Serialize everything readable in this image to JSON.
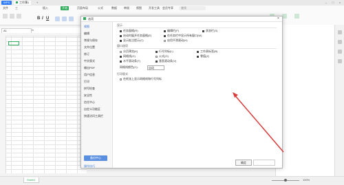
{
  "titlebar": {
    "app_name": "WPS",
    "tab_label": "工作簿1",
    "add_tab": "+"
  },
  "menubar": {
    "items": [
      "文件",
      "三",
      "插入",
      "开始",
      "页面布局",
      "公式",
      "数据",
      "审阅",
      "视图",
      "开发工具",
      "会员专享"
    ],
    "search_placeholder": "查找"
  },
  "formulabar": {
    "cell_ref": "A1",
    "fx": "fx"
  },
  "dialog": {
    "title": "选项",
    "close": "×",
    "nav": [
      "视图",
      "编辑",
      "常规与保存",
      "文件位置",
      "修订",
      "中文版式",
      "输出PDF",
      "用户信息",
      "打印",
      "拼写检查",
      "安全性",
      "信任中心",
      "自定义功能区",
      "快速访问工具栏"
    ],
    "backup_button": "备份中心",
    "tips_link": "操作技巧",
    "sections": {
      "show": "显示",
      "window": "窗口选项"
    },
    "show_options": [
      {
        "label": "任务窗格(R)",
        "checked": true
      },
      {
        "label": "编辑栏(F)",
        "checked": true
      },
      {
        "label": "状态栏(S)",
        "checked": true
      },
      {
        "label": "启动时展开任务窗格(E)",
        "checked": true
      },
      {
        "label": "在任务栏中显示所有窗口(W)",
        "checked": true
      },
      {
        "label": "显示批注提示(C)",
        "checked": true
      },
      {
        "label": "启用平滑滚动(H)",
        "checked": false
      }
    ],
    "window_options": [
      {
        "label": "分页预览(K)",
        "checked": false
      },
      {
        "label": "行号列标(L)",
        "checked": true
      },
      {
        "label": "工作表标签(B)",
        "checked": true
      },
      {
        "label": "网格线(G)",
        "checked": true
      },
      {
        "label": "公式(O)",
        "checked": false
      },
      {
        "label": "零值(Z)",
        "checked": true
      },
      {
        "label": "水平滚动条(T)",
        "checked": true
      },
      {
        "label": "垂直滚动条(V)",
        "checked": true
      }
    ],
    "gridline_color_label": "网格线颜色(C):",
    "gridline_color_value": "自动",
    "print_section": "打印版式",
    "print_option": {
      "label": "在纸张上显示网格线和行号列标",
      "checked": false
    },
    "ok_button": "确定",
    "cancel_button": ""
  },
  "statusbar": {
    "sheet_tab": "Sheet1",
    "zoom": "100%"
  },
  "colors": {
    "accent": "#2eaa5a",
    "brand": "#2f7cf6",
    "arrow": "#d93b3b"
  }
}
